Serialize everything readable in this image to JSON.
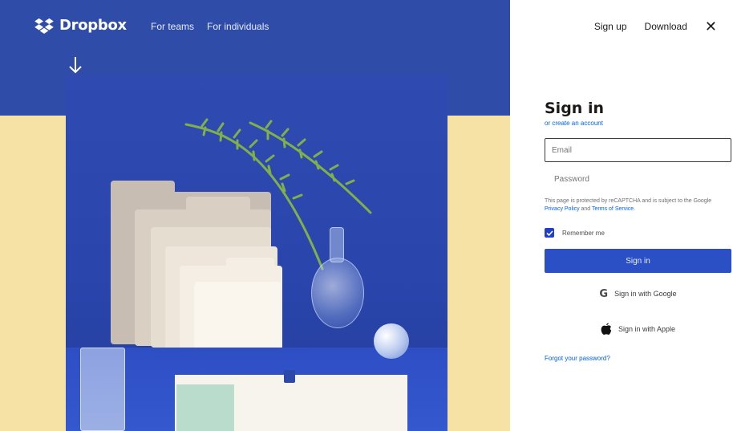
{
  "brand": {
    "name": "Dropbox"
  },
  "topnav": [
    {
      "label": "For teams"
    },
    {
      "label": "For individuals"
    }
  ],
  "header": {
    "signup_label": "Sign up",
    "download_label": "Download",
    "close_glyph": "✕"
  },
  "signin": {
    "title": "Sign in",
    "create_account_link": "or create an account",
    "email_placeholder": "Email",
    "password_placeholder": "Password",
    "recaptcha_notice_prefix": "This page is protected by reCAPTCHA and is subject to the Google ",
    "privacy_policy_link": "Privacy Policy",
    "notice_and": " and ",
    "terms_link": "Terms of Service",
    "notice_suffix": ".",
    "remember_label": "Remember me",
    "submit_label": "Sign in",
    "google_label": "Sign in with Google",
    "apple_label": "Sign in with Apple",
    "forgot_label": "Forgot your password?"
  },
  "colors": {
    "hero_blue": "#2f4da8",
    "hero_cream": "#f7e2a6",
    "primary_button": "#2b4fc4",
    "link": "#0061fe"
  },
  "icons": {
    "brand": "dropbox-logo-icon",
    "arrow": "arrow-down-icon",
    "close": "close-icon",
    "checkbox": "checkmark-icon",
    "google": "google-icon",
    "apple": "apple-icon"
  }
}
